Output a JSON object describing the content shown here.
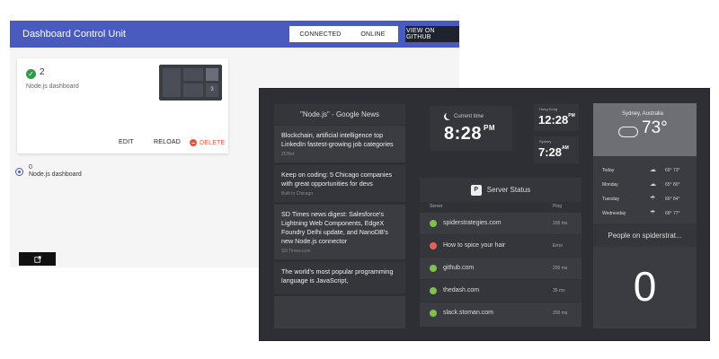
{
  "control_unit": {
    "title": "Dashboard Control Unit",
    "buttons": {
      "connected": "CONNECTED",
      "online": "ONLINE",
      "github": "VIEW ON GITHUB"
    },
    "card": {
      "count": "2",
      "name": "Node.js dashboard",
      "thumbnail_value": "3",
      "actions": {
        "edit": "EDIT",
        "reload": "RELOAD",
        "delete": "DELETE"
      }
    },
    "radio": {
      "number": "0",
      "label": "Node.js dashboard"
    },
    "open_icon": "external-link-icon"
  },
  "dashboard": {
    "news": {
      "title": "\"Node.js\" - Google News",
      "items": [
        {
          "title": "Blockchain, artificial intelligence top LinkedIn fastest-growing job categories",
          "source": "ZDNet"
        },
        {
          "title": "Keep on coding: 5 Chicago companies with great opportunities for devs",
          "source": "Built In Chicago"
        },
        {
          "title": "SD Times news digest: Salesforce's Lightning Web Components, EdgeX Foundry Delhi update, and NanoDB's new Node.js connector",
          "source": "SD Times.com"
        },
        {
          "title": "The world's most popular programming language is JavaScript,",
          "source": ""
        }
      ]
    },
    "clock_main": {
      "label": "Current time",
      "time": "8:28",
      "ampm": "PM"
    },
    "clock_small": [
      {
        "label": "Hong Kong",
        "time": "12:28",
        "ampm": "PM"
      },
      {
        "label": "Sydney",
        "time": "7:28",
        "ampm": "AM"
      }
    ],
    "weather": {
      "location": "Sydney, Australia",
      "temp": "73°",
      "days": [
        {
          "day": "Today",
          "icon": "☁",
          "range": "69° 73°"
        },
        {
          "day": "Monday",
          "icon": "☁",
          "range": "65° 80°"
        },
        {
          "day": "Tuesday",
          "icon": "☂",
          "range": "66° 84°"
        },
        {
          "day": "Wednesday",
          "icon": "☂",
          "range": "68° 77°"
        }
      ]
    },
    "server_status": {
      "title": "Server Status",
      "columns": {
        "server": "Server",
        "ping": "Ping"
      },
      "rows": [
        {
          "name": "spiderstrategies.com",
          "ping": "155 ms",
          "status_color": "#7dc24a"
        },
        {
          "name": "How to spice your hair",
          "ping": "Error",
          "status_color": "#e0625a"
        },
        {
          "name": "github.com",
          "ping": "200 ms",
          "status_color": "#7dc24a"
        },
        {
          "name": "thedash.com",
          "ping": "35 ms",
          "status_color": "#7dc24a"
        },
        {
          "name": "slack.stoman.com",
          "ping": "200 ms",
          "status_color": "#7dc24a"
        }
      ]
    },
    "people": {
      "title": "People on spiderstrat...",
      "value": "0"
    }
  }
}
